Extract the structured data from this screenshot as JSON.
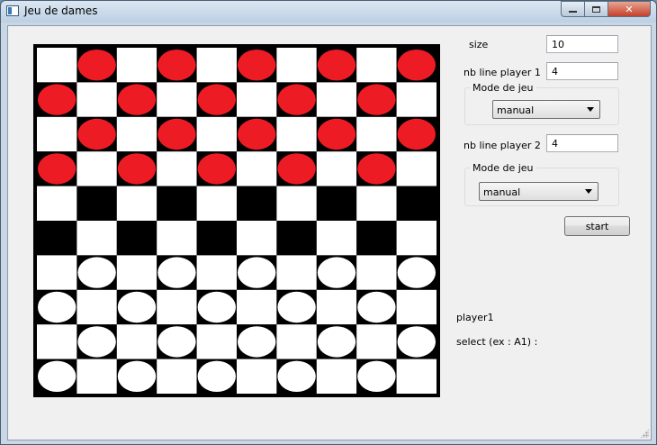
{
  "window": {
    "title": "Jeu de dames"
  },
  "board": {
    "size": 10,
    "player1_color": "#ed1c24",
    "player2_color": "#ffffff",
    "dark_square": "#000000",
    "light_square": "#ffffff",
    "rows": [
      [
        "",
        "r",
        "",
        "r",
        "",
        "r",
        "",
        "r",
        "",
        "r"
      ],
      [
        "r",
        "",
        "r",
        "",
        "r",
        "",
        "r",
        "",
        "r",
        ""
      ],
      [
        "",
        "r",
        "",
        "r",
        "",
        "r",
        "",
        "r",
        "",
        "r"
      ],
      [
        "r",
        "",
        "r",
        "",
        "r",
        "",
        "r",
        "",
        "r",
        ""
      ],
      [
        "",
        "",
        "",
        "",
        "",
        "",
        "",
        "",
        "",
        ""
      ],
      [
        "",
        "",
        "",
        "",
        "",
        "",
        "",
        "",
        "",
        ""
      ],
      [
        "",
        "w",
        "",
        "w",
        "",
        "w",
        "",
        "w",
        "",
        "w"
      ],
      [
        "w",
        "",
        "w",
        "",
        "w",
        "",
        "w",
        "",
        "w",
        ""
      ],
      [
        "",
        "w",
        "",
        "w",
        "",
        "w",
        "",
        "w",
        "",
        "w"
      ],
      [
        "w",
        "",
        "w",
        "",
        "w",
        "",
        "w",
        "",
        "w",
        ""
      ]
    ]
  },
  "settings": {
    "size_label": "size",
    "size_value": "10",
    "p1_lines_label": "nb line player 1",
    "p1_lines_value": "4",
    "p1_mode_title": "Mode de jeu",
    "p1_mode_value": "manual",
    "p2_lines_label": "nb line player 2",
    "p2_lines_value": "4",
    "p2_mode_title": "Mode de jeu",
    "p2_mode_value": "manual",
    "start_label": "start"
  },
  "status": {
    "current_player": "player1",
    "prompt": "select (ex : A1) :"
  }
}
